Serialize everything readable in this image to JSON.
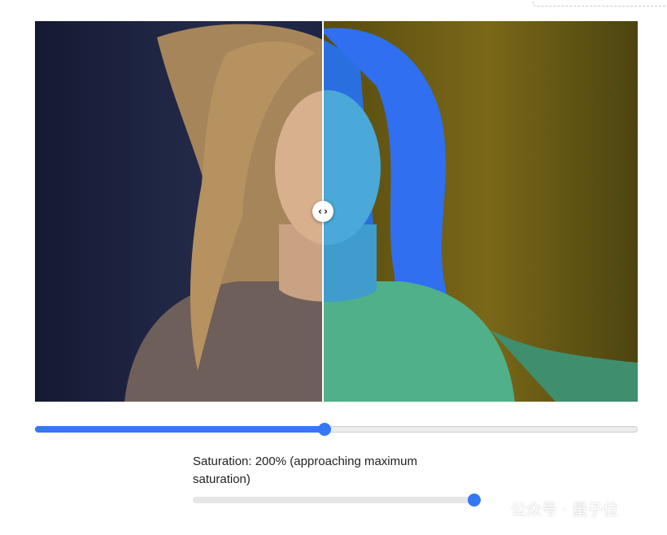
{
  "compare": {
    "handle_left_glyph": "‹",
    "handle_right_glyph": "›",
    "split_position_percent": 48
  },
  "saturation": {
    "label": "Saturation: 200% (approaching maximum saturation)",
    "value_percent": 200,
    "slider_fill_fraction": 1.0
  },
  "watermark": {
    "text": "公众号 · 量子位",
    "icon": "wechat-icon"
  },
  "colors": {
    "accent": "#3478f6",
    "left_background": "#1e2440",
    "right_background": "#6a5a12",
    "right_tint": "#2a78d6"
  }
}
